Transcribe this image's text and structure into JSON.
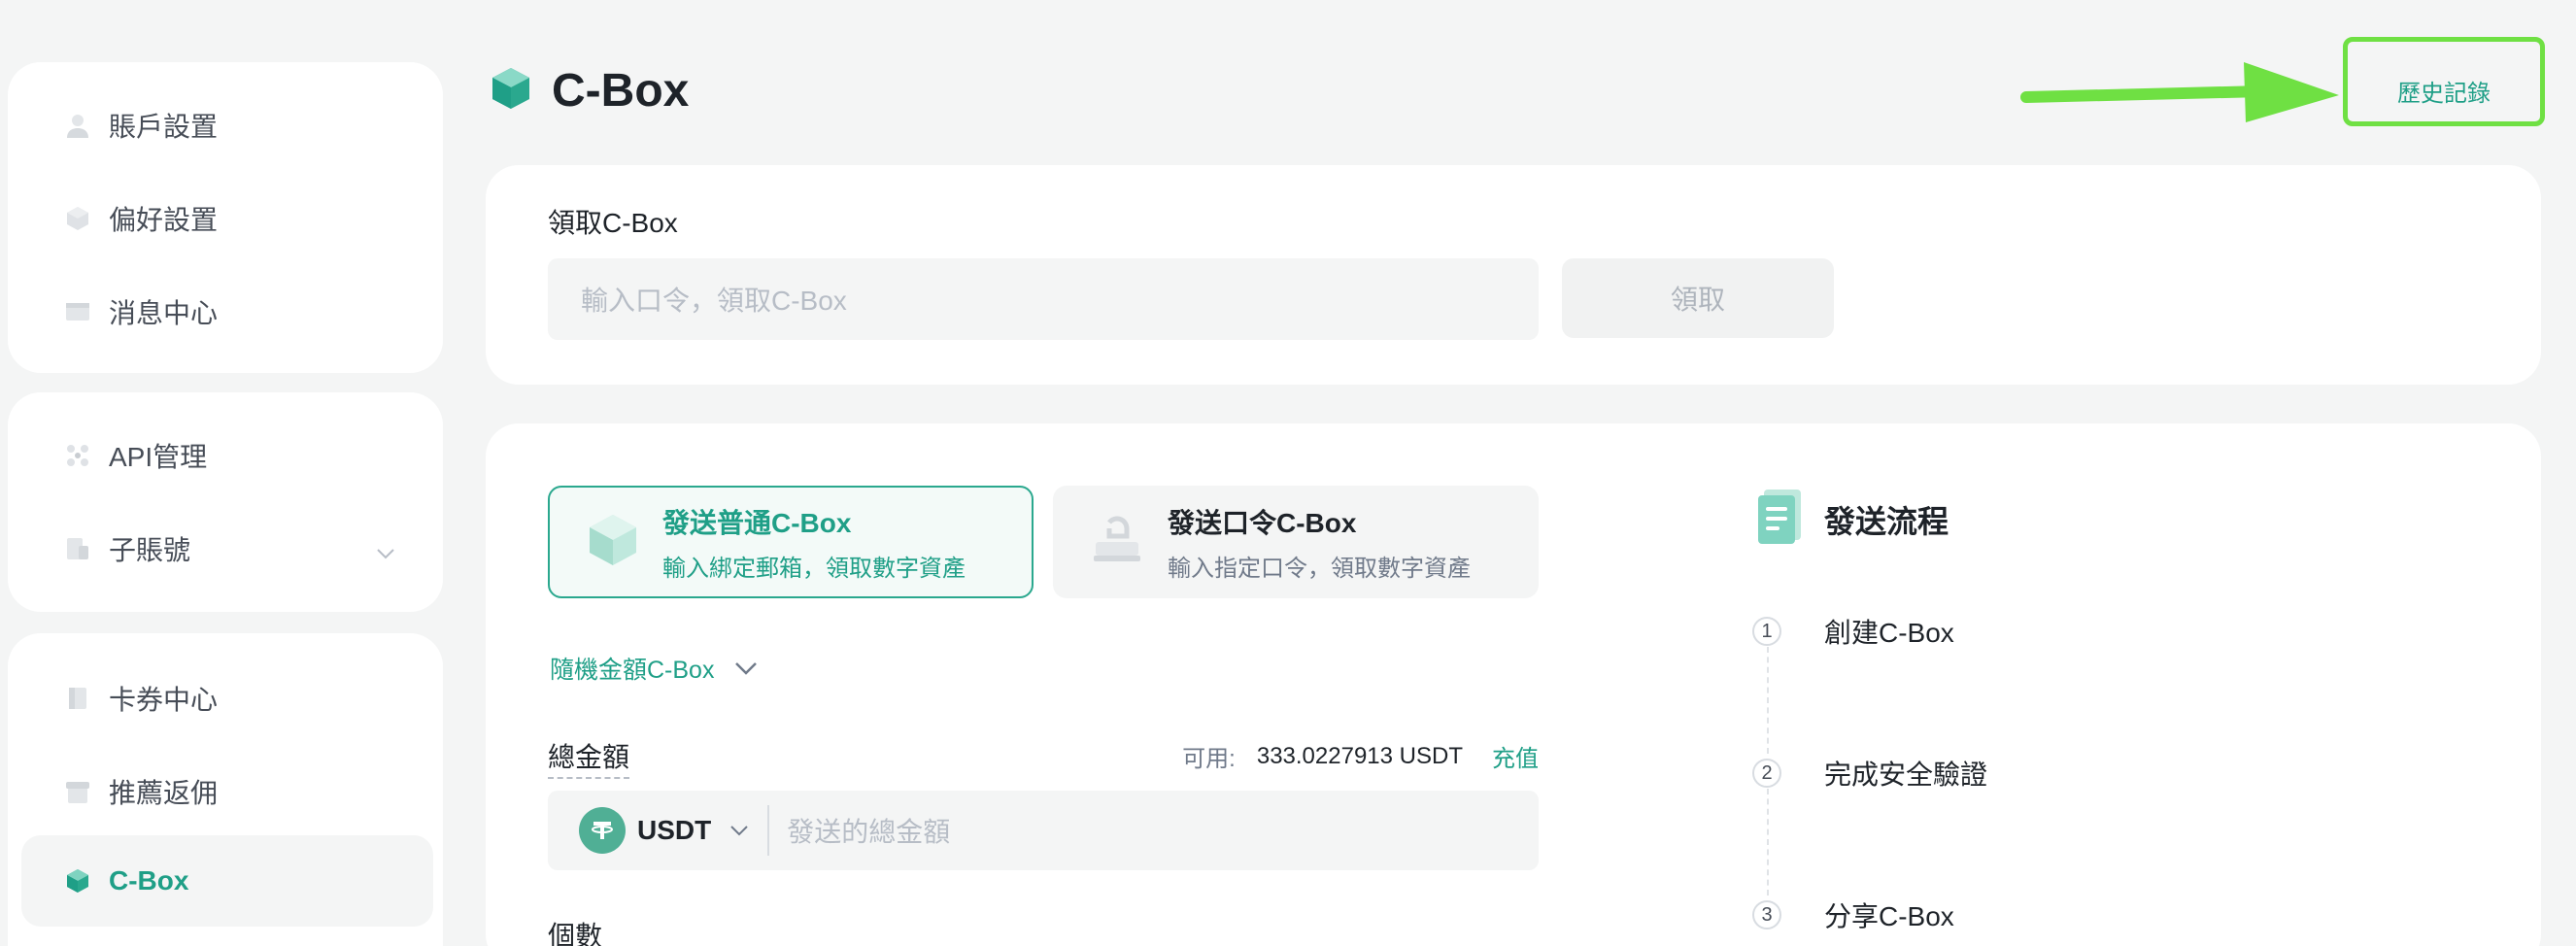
{
  "sidebar": {
    "group1": [
      {
        "label": "賬戶設置",
        "icon": "user-icon"
      },
      {
        "label": "偏好設置",
        "icon": "preferences-icon"
      },
      {
        "label": "消息中心",
        "icon": "message-icon"
      }
    ],
    "group2": [
      {
        "label": "API管理",
        "icon": "api-icon"
      },
      {
        "label": "子賬號",
        "icon": "subaccount-icon"
      }
    ],
    "group3": [
      {
        "label": "卡券中心",
        "icon": "coupon-icon"
      },
      {
        "label": "推薦返佣",
        "icon": "referral-icon"
      },
      {
        "label": "C-Box",
        "icon": "cbox-icon"
      }
    ]
  },
  "header": {
    "title": "C-Box",
    "history_label": "歷史記錄"
  },
  "receive": {
    "title": "領取C-Box",
    "placeholder": "輸入口令，領取C-Box",
    "button": "領取"
  },
  "send": {
    "options": [
      {
        "title": "發送普通C-Box",
        "desc": "輸入綁定郵箱，領取數字資產"
      },
      {
        "title": "發送口令C-Box",
        "desc": "輸入指定口令，領取數字資產"
      }
    ],
    "mode": "隨機金額C-Box",
    "total_label": "總金額",
    "available_label": "可用:",
    "available_value": "333.0227913 USDT",
    "recharge": "充值",
    "coin": "USDT",
    "amount_placeholder": "發送的總金額",
    "count_label": "個數"
  },
  "flow": {
    "title": "發送流程",
    "steps": [
      {
        "num": "1",
        "label": "創建C-Box"
      },
      {
        "num": "2",
        "label": "完成安全驗證"
      },
      {
        "num": "3",
        "label": "分享C-Box"
      }
    ]
  },
  "colors": {
    "accent": "#1f9f87",
    "highlight": "#6fe043",
    "background": "#f4f5f5"
  }
}
